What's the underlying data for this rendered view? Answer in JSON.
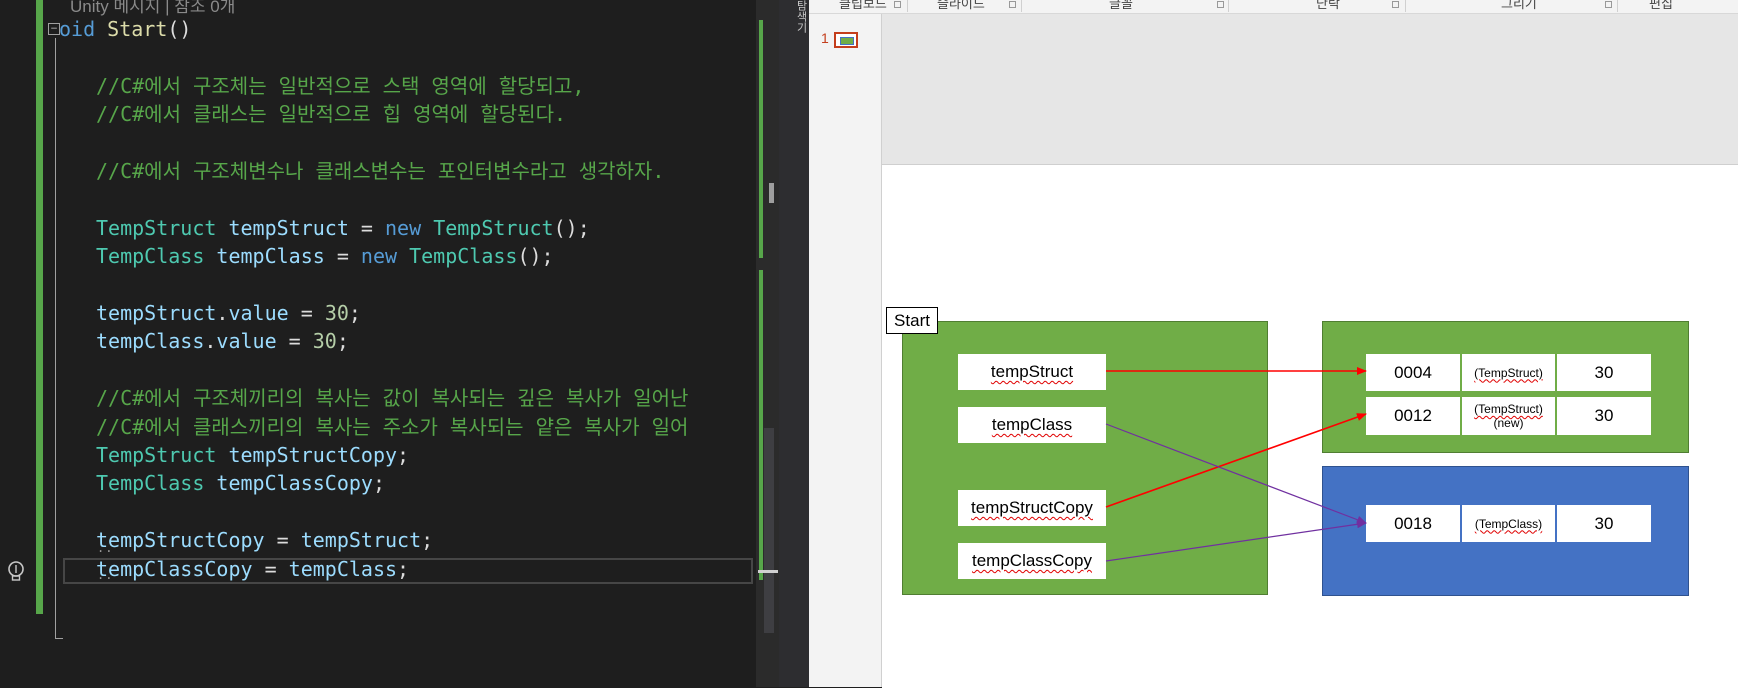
{
  "editor": {
    "codelens": "Unity 메시지 | 참조 0개",
    "fold_glyph": "−",
    "lines": [
      {
        "segments": [
          {
            "c": "kw",
            "t": "oid "
          },
          {
            "c": "fn",
            "t": "Start"
          },
          {
            "c": "plain",
            "t": "()"
          }
        ]
      },
      {
        "segments": []
      },
      {
        "segments": [
          {
            "c": "comment",
            "t": "//C#에서 구조체는 일반적으로 스택 영역에 할당되고,"
          }
        ]
      },
      {
        "segments": [
          {
            "c": "comment",
            "t": "//C#에서 클래스는 일반적으로 힙 영역에 할당된다."
          }
        ]
      },
      {
        "segments": []
      },
      {
        "segments": [
          {
            "c": "comment",
            "t": "//C#에서 구조체변수나 클래스변수는 포인터변수라고 생각하자."
          }
        ]
      },
      {
        "segments": []
      },
      {
        "segments": [
          {
            "c": "type",
            "t": "TempStruct"
          },
          {
            "c": "plain",
            "t": " "
          },
          {
            "c": "var",
            "t": "tempStruct"
          },
          {
            "c": "plain",
            "t": " = "
          },
          {
            "c": "kw",
            "t": "new"
          },
          {
            "c": "plain",
            "t": " "
          },
          {
            "c": "type",
            "t": "TempStruct"
          },
          {
            "c": "plain",
            "t": "();"
          }
        ]
      },
      {
        "segments": [
          {
            "c": "type",
            "t": "TempClass"
          },
          {
            "c": "plain",
            "t": " "
          },
          {
            "c": "var",
            "t": "tempClass"
          },
          {
            "c": "plain",
            "t": " = "
          },
          {
            "c": "kw",
            "t": "new"
          },
          {
            "c": "plain",
            "t": " "
          },
          {
            "c": "type",
            "t": "TempClass"
          },
          {
            "c": "plain",
            "t": "();"
          }
        ]
      },
      {
        "segments": []
      },
      {
        "segments": [
          {
            "c": "var",
            "t": "tempStruct"
          },
          {
            "c": "plain",
            "t": "."
          },
          {
            "c": "var",
            "t": "value"
          },
          {
            "c": "plain",
            "t": " = "
          },
          {
            "c": "num",
            "t": "30"
          },
          {
            "c": "plain",
            "t": ";"
          }
        ]
      },
      {
        "segments": [
          {
            "c": "var",
            "t": "tempClass"
          },
          {
            "c": "plain",
            "t": "."
          },
          {
            "c": "var",
            "t": "value"
          },
          {
            "c": "plain",
            "t": " = "
          },
          {
            "c": "num",
            "t": "30"
          },
          {
            "c": "plain",
            "t": ";"
          }
        ]
      },
      {
        "segments": []
      },
      {
        "segments": [
          {
            "c": "comment",
            "t": "//C#에서 구조체끼리의 복사는 값이 복사되는 깊은 복사가 일어난"
          }
        ]
      },
      {
        "segments": [
          {
            "c": "comment",
            "t": "//C#에서 클래스끼리의 복사는 주소가 복사되는 얕은 복사가 일어"
          }
        ]
      },
      {
        "segments": [
          {
            "c": "type",
            "t": "TempStruct"
          },
          {
            "c": "plain",
            "t": " "
          },
          {
            "c": "var",
            "t": "tempStructCopy"
          },
          {
            "c": "plain",
            "t": ";"
          }
        ]
      },
      {
        "segments": [
          {
            "c": "type",
            "t": "TempClass"
          },
          {
            "c": "plain",
            "t": " "
          },
          {
            "c": "var",
            "t": "tempClassCopy"
          },
          {
            "c": "plain",
            "t": ";"
          }
        ]
      },
      {
        "segments": []
      },
      {
        "segments": [
          {
            "c": "var",
            "t": "tempStructCopy"
          },
          {
            "c": "plain",
            "t": " = "
          },
          {
            "c": "var",
            "t": "tempStruct"
          },
          {
            "c": "plain",
            "t": ";"
          }
        ]
      },
      {
        "segments": [
          {
            "c": "var",
            "t": "tempClassCopy"
          },
          {
            "c": "plain",
            "t": " = "
          },
          {
            "c": "var",
            "t": "tempClass"
          },
          {
            "c": "plain",
            "t": ";"
          }
        ]
      }
    ],
    "splitter_text": "탐색기"
  },
  "ppt": {
    "ribbon_groups": [
      "클립보드",
      "슬라이드",
      "글꼴",
      "단락",
      "그리기",
      "편집"
    ],
    "slide_number": "1",
    "start_label": "Start",
    "variables": [
      "tempStruct",
      "tempClass",
      "tempStructCopy",
      "tempClassCopy"
    ],
    "struct_rows": [
      {
        "addr": "0004",
        "type_line1": "(TempStruct)",
        "type_line2": "",
        "value": "30"
      },
      {
        "addr": "0012",
        "type_line1": "(TempStruct)",
        "type_line2": "(new)",
        "value": "30"
      }
    ],
    "class_row": {
      "addr": "0018",
      "type_line1": "(TempClass)",
      "value": "30"
    },
    "colors": {
      "stack_green": "#70ad47",
      "heap_blue": "#4472c4",
      "struct_arrow": "#ff0000",
      "class_arrow": "#7030a0"
    }
  }
}
